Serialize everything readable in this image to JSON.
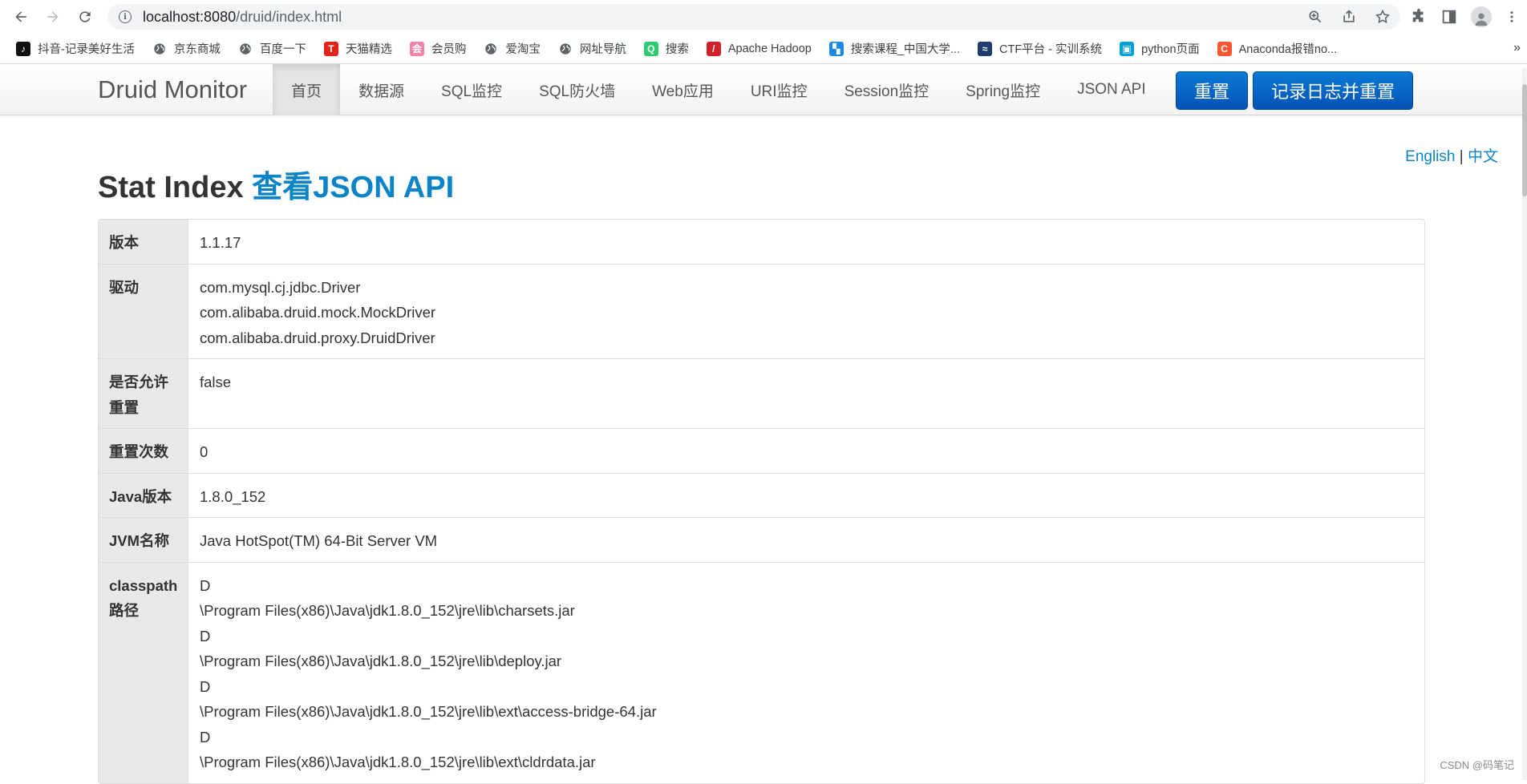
{
  "browser": {
    "url_host": "localhost:8080",
    "url_path": "/druid/index.html",
    "bookmarks": [
      {
        "label": "抖音-记录美好生活",
        "icon": "tiktok-icon",
        "color": "#111111",
        "glyph": "♪"
      },
      {
        "label": "京东商城",
        "icon": "globe-icon",
        "color": "#5f6368",
        "glyph": ""
      },
      {
        "label": "百度一下",
        "icon": "globe-icon",
        "color": "#5f6368",
        "glyph": ""
      },
      {
        "label": "天猫精选",
        "icon": "tmall-icon",
        "color": "#e2231a",
        "glyph": "T"
      },
      {
        "label": "会员购",
        "icon": "bilibili-shop-icon",
        "color": "#f582a7",
        "glyph": "会"
      },
      {
        "label": "爱淘宝",
        "icon": "globe-icon",
        "color": "#5f6368",
        "glyph": ""
      },
      {
        "label": "网址导航",
        "icon": "globe-icon",
        "color": "#5f6368",
        "glyph": ""
      },
      {
        "label": "搜索",
        "icon": "search-engine-icon",
        "color": "#2ecc71",
        "glyph": "Q"
      },
      {
        "label": "Apache Hadoop",
        "icon": "feather-icon",
        "color": "#d22128",
        "glyph": "/"
      },
      {
        "label": "搜索课程_中国大学...",
        "icon": "mooc-icon",
        "color": "#1e88e5",
        "glyph": "▚"
      },
      {
        "label": "CTF平台 - 实训系统",
        "icon": "ctf-icon",
        "color": "#1e3c72",
        "glyph": "≈"
      },
      {
        "label": "python页面",
        "icon": "bilibili-icon",
        "color": "#00a1d6",
        "glyph": "▣"
      },
      {
        "label": "Anaconda报错no...",
        "icon": "csdn-icon",
        "color": "#fc5531",
        "glyph": "C"
      }
    ],
    "more": "»"
  },
  "navbar": {
    "brand": "Druid Monitor",
    "items": [
      "首页",
      "数据源",
      "SQL监控",
      "SQL防火墙",
      "Web应用",
      "URI监控",
      "Session监控",
      "Spring监控",
      "JSON API"
    ],
    "active_index": 0,
    "reset_label": "重置",
    "log_reset_label": "记录日志并重置"
  },
  "lang": {
    "english": "English",
    "separator": "|",
    "chinese": "中文"
  },
  "page": {
    "title": "Stat Index",
    "title_link": "查看JSON API"
  },
  "stats": [
    {
      "key": "版本",
      "lines": [
        "1.1.17"
      ]
    },
    {
      "key": "驱动",
      "lines": [
        "com.mysql.cj.jdbc.Driver",
        "com.alibaba.druid.mock.MockDriver",
        "com.alibaba.druid.proxy.DruidDriver"
      ]
    },
    {
      "key": "是否允许重置",
      "lines": [
        "false"
      ]
    },
    {
      "key": "重置次数",
      "lines": [
        "0"
      ]
    },
    {
      "key": "Java版本",
      "lines": [
        "1.8.0_152"
      ]
    },
    {
      "key": "JVM名称",
      "lines": [
        "Java HotSpot(TM) 64-Bit Server VM"
      ]
    },
    {
      "key": "classpath路径",
      "lines": [
        "D",
        "\\Program Files(x86)\\Java\\jdk1.8.0_152\\jre\\lib\\charsets.jar",
        "D",
        "\\Program Files(x86)\\Java\\jdk1.8.0_152\\jre\\lib\\deploy.jar",
        "D",
        "\\Program Files(x86)\\Java\\jdk1.8.0_152\\jre\\lib\\ext\\access-bridge-64.jar",
        "D",
        "\\Program Files(x86)\\Java\\jdk1.8.0_152\\jre\\lib\\ext\\cldrdata.jar"
      ]
    }
  ],
  "watermark": "CSDN @码笔记"
}
